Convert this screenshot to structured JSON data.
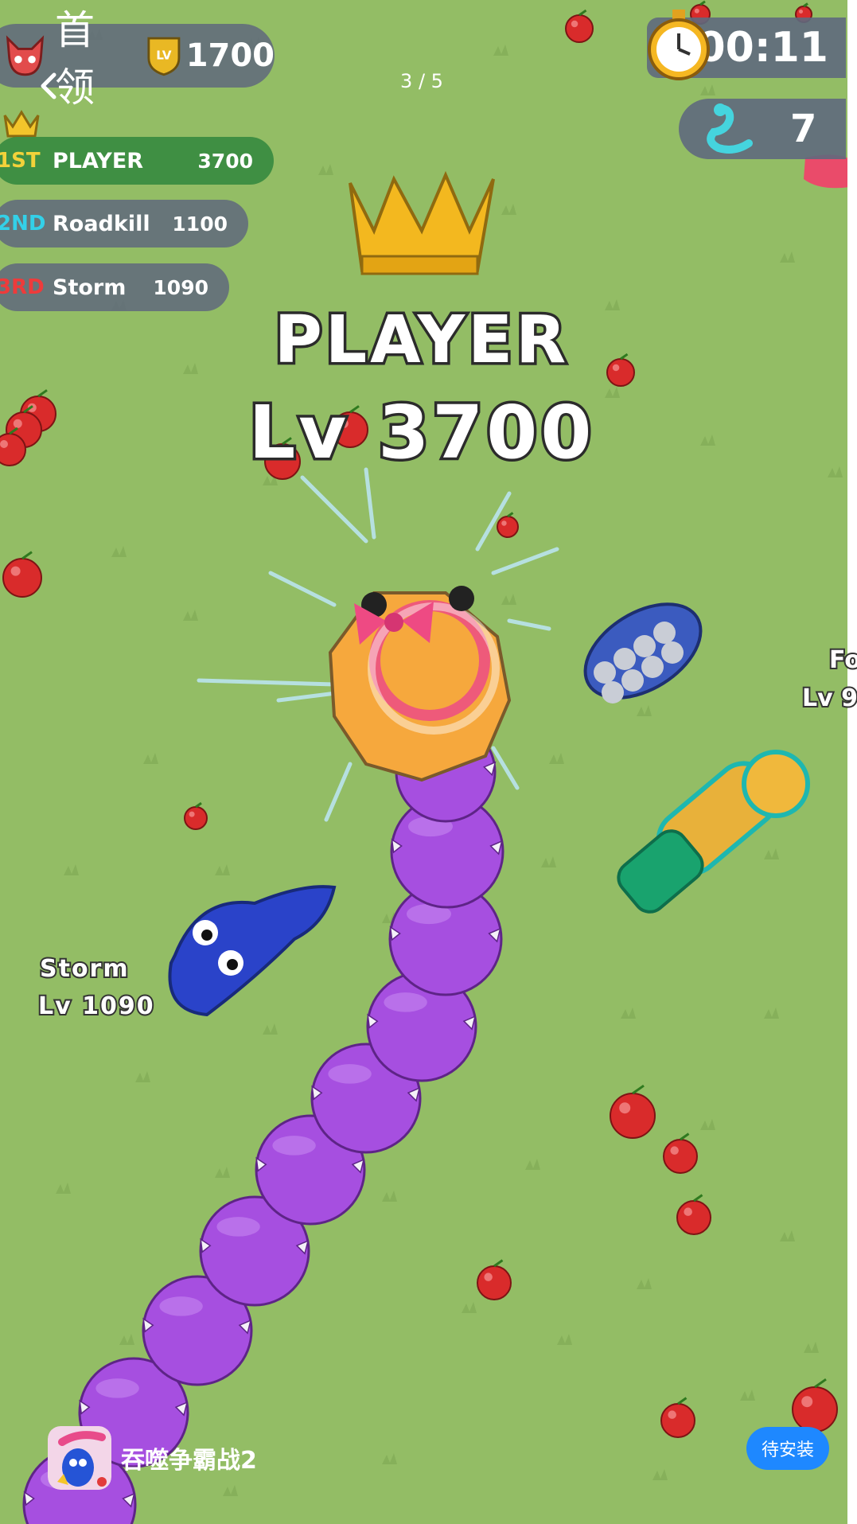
{
  "viewer": {
    "page_counter": "3 / 5"
  },
  "hud": {
    "top_leader_label": "首领",
    "top_leader_badge": "LV",
    "top_leader_score": "1700",
    "timer": "00:11",
    "kills": "7"
  },
  "leaderboard": [
    {
      "rank": "1ST",
      "name": "PLAYER",
      "score": "3700",
      "rank_color": "#f2d23a"
    },
    {
      "rank": "2ND",
      "name": "Roadkill",
      "score": "1100",
      "rank_color": "#33d0e8"
    },
    {
      "rank": "3RD",
      "name": "Storm",
      "score": "1090",
      "rank_color": "#ee3b3b"
    }
  ],
  "player": {
    "name": "PLAYER",
    "level": "Lv 3700"
  },
  "enemies": {
    "storm_name": "Storm",
    "storm_level": "Lv 1090",
    "edge_name": "Fo",
    "edge_level": "Lv 9"
  },
  "ad": {
    "app_name": "吞噬争霸战2",
    "install_label": "待安装"
  },
  "colors": {
    "grass": "#93bd65",
    "player_body": "#a64fe0",
    "accent": "#1e88ff"
  }
}
